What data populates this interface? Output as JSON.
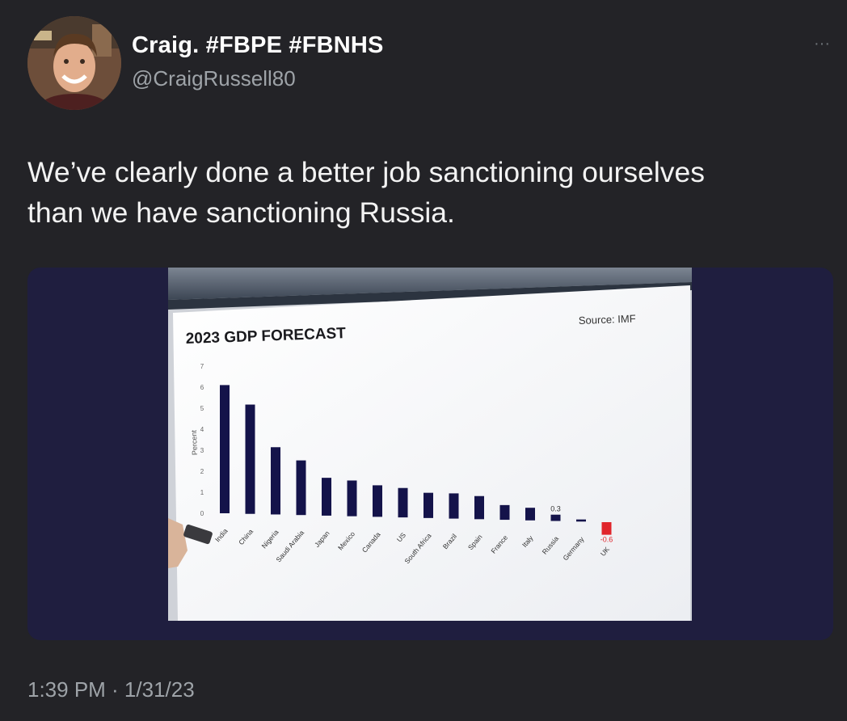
{
  "tweet": {
    "author_name": "Craig. #FBPE #FBNHS",
    "author_handle": "@CraigRussell80",
    "more_label": "···",
    "text": "We’ve clearly done a better job sanctioning ourselves\nthan we have sanctioning Russia.",
    "timestamp": "1:39 PM · 1/31/23"
  },
  "colors": {
    "background": "#232327",
    "media_background": "#1f1e3f",
    "bar": "#14134a",
    "bar_negative": "#e0262c"
  },
  "chart_data": {
    "type": "bar",
    "title": "2023 GDP FORECAST",
    "source": "Source: IMF",
    "ylabel": "Percent",
    "ylim": [
      -1,
      7
    ],
    "yticks": [
      0,
      1,
      2,
      3,
      4,
      5,
      6,
      7
    ],
    "categories": [
      "India",
      "China",
      "Nigeria",
      "Saudi Arabia",
      "Japan",
      "Mexico",
      "Canada",
      "US",
      "South Africa",
      "Brazil",
      "Spain",
      "France",
      "Italy",
      "Russia",
      "Germany",
      "UK"
    ],
    "values": [
      6.1,
      5.2,
      3.2,
      2.6,
      1.8,
      1.7,
      1.5,
      1.4,
      1.2,
      1.2,
      1.1,
      0.7,
      0.6,
      0.3,
      0.1,
      -0.6
    ],
    "data_labels": [
      {
        "category": "Russia",
        "text": "0.3"
      },
      {
        "category": "UK",
        "text": "-0.6"
      }
    ]
  }
}
